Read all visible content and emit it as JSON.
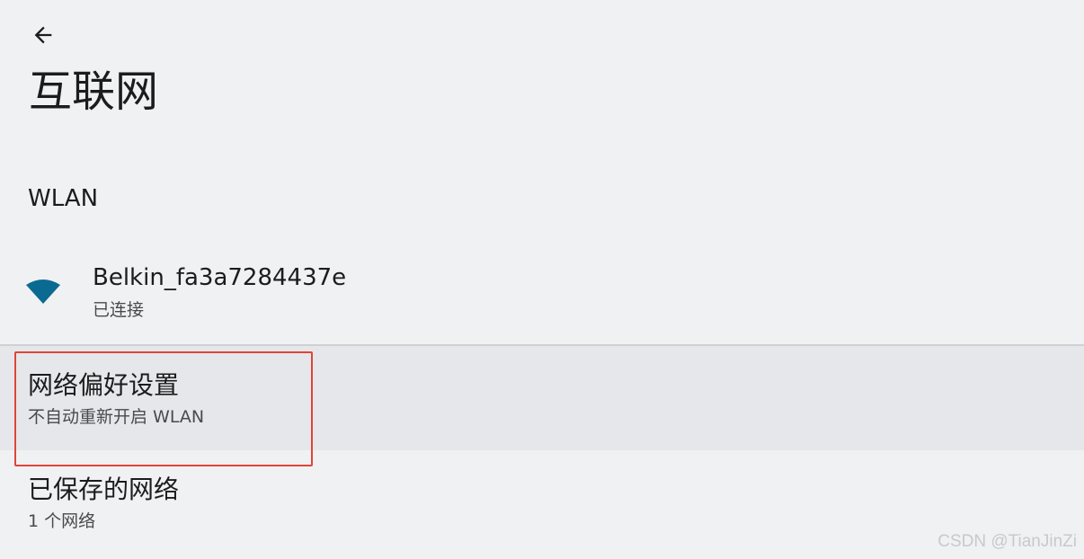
{
  "header": {
    "back_icon": "arrow-left-icon",
    "title": "互联网"
  },
  "section": {
    "label": "WLAN"
  },
  "connected_network": {
    "icon": "wifi-icon",
    "icon_color": "#0b6a91",
    "name": "Belkin_fa3a7284437e",
    "status": "已连接"
  },
  "preferences": {
    "title": "网络偏好设置",
    "subtitle": "不自动重新开启 WLAN",
    "highlight_color": "#e0453a"
  },
  "saved_networks": {
    "title": "已保存的网络",
    "subtitle": "1 个网络"
  },
  "watermark": "CSDN @TianJinZi"
}
